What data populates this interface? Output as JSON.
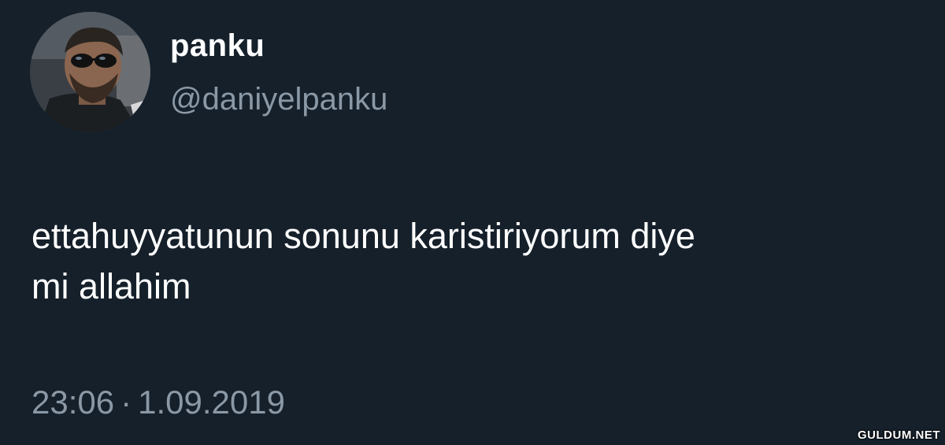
{
  "author": {
    "display_name": "panku",
    "handle": "@daniyelpanku",
    "avatar_icon": "profile-photo-avatar"
  },
  "tweet": {
    "text_line_1": "ettahuyyatunun sonunu karistiriyorum diye",
    "text_line_2": "mi allahim",
    "time": "23:06",
    "separator": "·",
    "date": "1.09.2019"
  },
  "watermark": "GULDUM.NET",
  "colors": {
    "background": "#15202b",
    "primary_text": "#ffffff",
    "secondary_text": "#8b98a5"
  }
}
